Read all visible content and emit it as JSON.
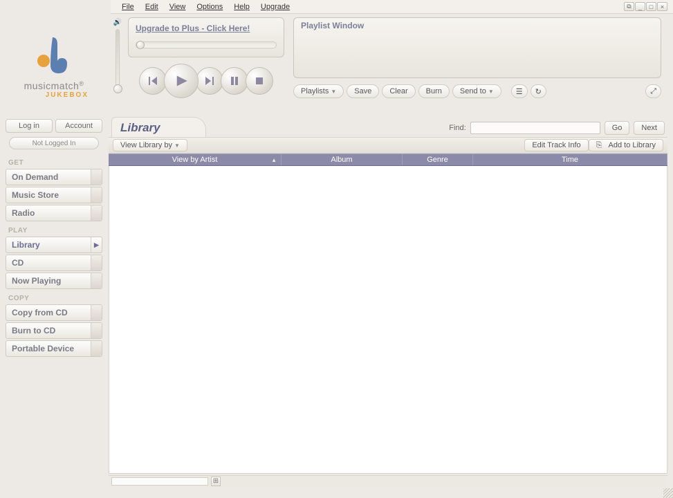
{
  "menu": {
    "file": "File",
    "edit": "Edit",
    "view": "View",
    "options": "Options",
    "help": "Help",
    "upgrade": "Upgrade"
  },
  "window_buttons": {
    "undock": "⧉",
    "minimize": "_",
    "maximize": "□",
    "close": "×"
  },
  "logo": {
    "brand": "musicmatch",
    "sub": "JUKEBOX",
    "reg": "®"
  },
  "upgrade_banner": "Upgrade to Plus - Click Here!",
  "playlist_window_title": "Playlist Window",
  "playlist_toolbar": {
    "playlists": "Playlists",
    "save": "Save",
    "clear": "Clear",
    "burn": "Burn",
    "sendto": "Send to"
  },
  "account": {
    "login": "Log in",
    "account": "Account",
    "status": "Not Logged In"
  },
  "nav": {
    "get_heading": "GET",
    "get": [
      "On Demand",
      "Music Store",
      "Radio"
    ],
    "play_heading": "PLAY",
    "play": [
      "Library",
      "CD",
      "Now Playing"
    ],
    "copy_heading": "COPY",
    "copy": [
      "Copy from CD",
      "Burn to CD",
      "Portable Device"
    ]
  },
  "library": {
    "title": "Library",
    "find_label": "Find:",
    "go": "Go",
    "next": "Next",
    "view_by": "View Library by",
    "edit_track": "Edit Track Info",
    "add": "Add to Library",
    "columns": {
      "artist": "View by Artist",
      "album": "Album",
      "genre": "Genre",
      "time": "Time"
    }
  }
}
